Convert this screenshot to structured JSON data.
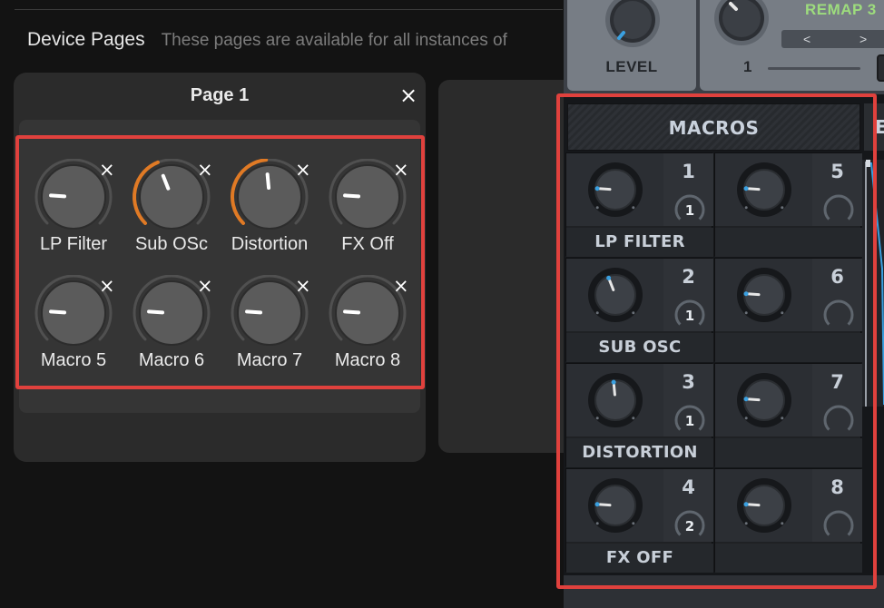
{
  "device_pages": {
    "title": "Device Pages",
    "description": "These pages are available for all instances of",
    "page": {
      "title": "Page 1",
      "close_icon": "×",
      "knobs": [
        {
          "label": "LP Filter",
          "value": 0.18,
          "mod": 0
        },
        {
          "label": "Sub OSc",
          "value": 0.42,
          "mod": 0.42
        },
        {
          "label": "Distortion",
          "value": 0.48,
          "mod": 0.48
        },
        {
          "label": "FX Off",
          "value": 0.18,
          "mod": 0
        },
        {
          "label": "Macro 5",
          "value": 0.18,
          "mod": 0
        },
        {
          "label": "Macro 6",
          "value": 0.18,
          "mod": 0
        },
        {
          "label": "Macro 7",
          "value": 0.18,
          "mod": 0
        },
        {
          "label": "Macro 8",
          "value": 0.18,
          "mod": 0
        }
      ],
      "remove_icon": "×"
    }
  },
  "synth": {
    "level_label": "LEVEL",
    "remap_title": "REMAP 3",
    "remap_prev": "<",
    "remap_next": ">",
    "remap_value": "1",
    "macros_title": "MACROS",
    "macros_next_partial": "E",
    "macros": [
      {
        "number": "1",
        "name": "LP FILTER",
        "mod_count": "1",
        "value": 0.18
      },
      {
        "number": "2",
        "name": "SUB OSC",
        "mod_count": "1",
        "value": 0.42
      },
      {
        "number": "3",
        "name": "DISTORTION",
        "mod_count": "1",
        "value": 0.48
      },
      {
        "number": "4",
        "name": "FX OFF",
        "mod_count": "2",
        "value": 0.18
      },
      {
        "number": "5",
        "name": "",
        "mod_count": "",
        "value": 0.18
      },
      {
        "number": "6",
        "name": "",
        "mod_count": "",
        "value": 0.18
      },
      {
        "number": "7",
        "name": "",
        "mod_count": "",
        "value": 0.18
      },
      {
        "number": "8",
        "name": "",
        "mod_count": "",
        "value": 0.18
      }
    ]
  },
  "colors": {
    "highlight": "#e0413d",
    "mod_arc": "#e07a25",
    "macro_accent": "#3aa0e0",
    "remap_green": "#9ddc7d"
  }
}
